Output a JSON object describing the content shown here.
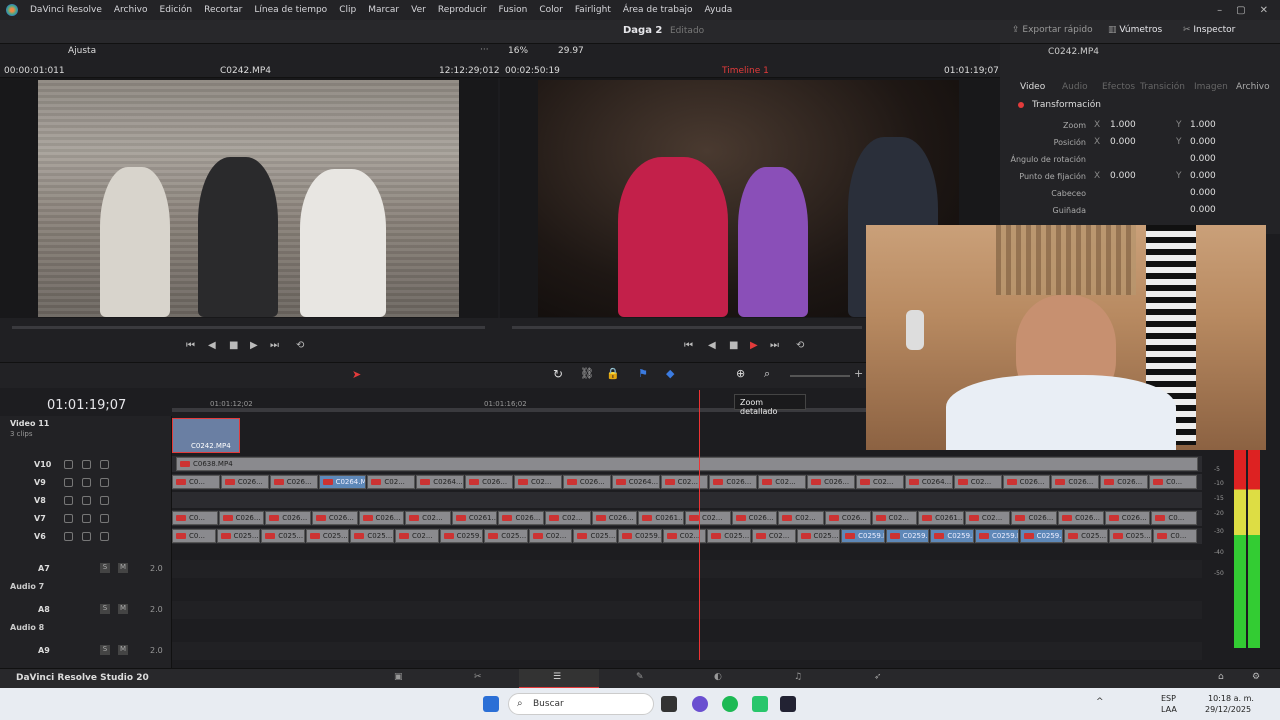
{
  "menu": [
    "DaVinci Resolve",
    "Archivo",
    "Edición",
    "Recortar",
    "Línea de tiempo",
    "Clip",
    "Marcar",
    "Ver",
    "Reproducir",
    "Fusion",
    "Color",
    "Fairlight",
    "Área de trabajo",
    "Ayuda"
  ],
  "title": {
    "project": "Daga 2",
    "status": "Editado"
  },
  "toolbar": {
    "export": "Exportar rápido",
    "meters": "Vúmetros",
    "inspector": "Inspector"
  },
  "source_viewer": {
    "zoom": "Ajusta",
    "timecode_left": "00:00:01:011",
    "clip": "C0242.MP4",
    "timecode_right": "12:12:29;012"
  },
  "timeline_viewer": {
    "zoom": "16%",
    "fps": "29.97",
    "timecode_left": "00:02:50:19",
    "name": "Timeline 1",
    "timecode_right": "01:01:19;07"
  },
  "inspector": {
    "clip": "C0242.MP4",
    "tabs": [
      "Video",
      "Audio",
      "Efectos",
      "Transición",
      "Imagen",
      "Archivo"
    ],
    "section": "Transformación",
    "rows": [
      {
        "label": "Zoom",
        "x": "1.000",
        "y": "1.000"
      },
      {
        "label": "Posición",
        "x": "0.000",
        "y": "0.000"
      },
      {
        "label": "Ángulo de rotación",
        "v": "0.000"
      },
      {
        "label": "Punto de fijación",
        "x": "0.000",
        "y": "0.000"
      },
      {
        "label": "Cabeceo",
        "v": "0.000"
      },
      {
        "label": "Guiñada",
        "v": "0.000"
      }
    ],
    "axis_x": "X",
    "axis_y": "Y"
  },
  "timeline": {
    "timecode": "01:01:19;07",
    "ruler": [
      "01:01:12;02",
      "01:01:16;02"
    ],
    "tooltip": "Zoom detallado",
    "video11": {
      "name": "Video 11",
      "clips": "3 clips"
    },
    "tracks": [
      {
        "id": "V10",
        "clips": [
          "C0638.MP4"
        ]
      },
      {
        "id": "V9",
        "clips": [
          "C0...",
          "C026...",
          "C026...",
          "C0264.MP4",
          "C02...",
          "C0264...",
          "C026...",
          "C02...",
          "C026...",
          "C0264...",
          "C02...",
          "C026...",
          "C02...",
          "C026...",
          "C02...",
          "C0264...",
          "C02...",
          "C026...",
          "C026...",
          "C026...",
          "C0..."
        ]
      },
      {
        "id": "V8",
        "clips": []
      },
      {
        "id": "V7",
        "clips": [
          "C0...",
          "C026...",
          "C026...",
          "C026...",
          "C026...",
          "C02...",
          "C0261...",
          "C026...",
          "C02...",
          "C026...",
          "C0261...",
          "C02...",
          "C026...",
          "C02...",
          "C026...",
          "C02...",
          "C0261...",
          "C02...",
          "C026...",
          "C026...",
          "C026...",
          "C0..."
        ]
      },
      {
        "id": "V6",
        "clips": [
          "C0...",
          "C025...",
          "C025...",
          "C025...",
          "C025...",
          "C02...",
          "C0259...",
          "C025...",
          "C02...",
          "C025...",
          "C0259...",
          "C02...",
          "C025...",
          "C02...",
          "C025...",
          "C0259.M...",
          "C0259.MP4",
          "C0259.M...",
          "C0259.MP4",
          "C0259.MP4",
          "C025...",
          "C025...",
          "C0..."
        ]
      }
    ],
    "audio": [
      {
        "id": "A7",
        "name": "Audio 7",
        "vol": "2.0"
      },
      {
        "id": "A8",
        "name": "Audio 8",
        "vol": "2.0"
      },
      {
        "id": "A9",
        "name": "",
        "vol": "2.0"
      }
    ],
    "top_clip": "C0242.MP4"
  },
  "meter_ticks": [
    "-5",
    "-10",
    "-15",
    "-20",
    "-30",
    "-40",
    "-50"
  ],
  "footer": {
    "app": "DaVinci Resolve Studio 20"
  },
  "taskbar": {
    "search": "Buscar",
    "lang1": "ESP",
    "lang2": "LAA",
    "time": "10:18 a. m.",
    "date": "29/12/2025"
  },
  "colors": {
    "accent": "#e33b3b",
    "clip_sel": "#5e88b8",
    "marker": "#c33"
  }
}
